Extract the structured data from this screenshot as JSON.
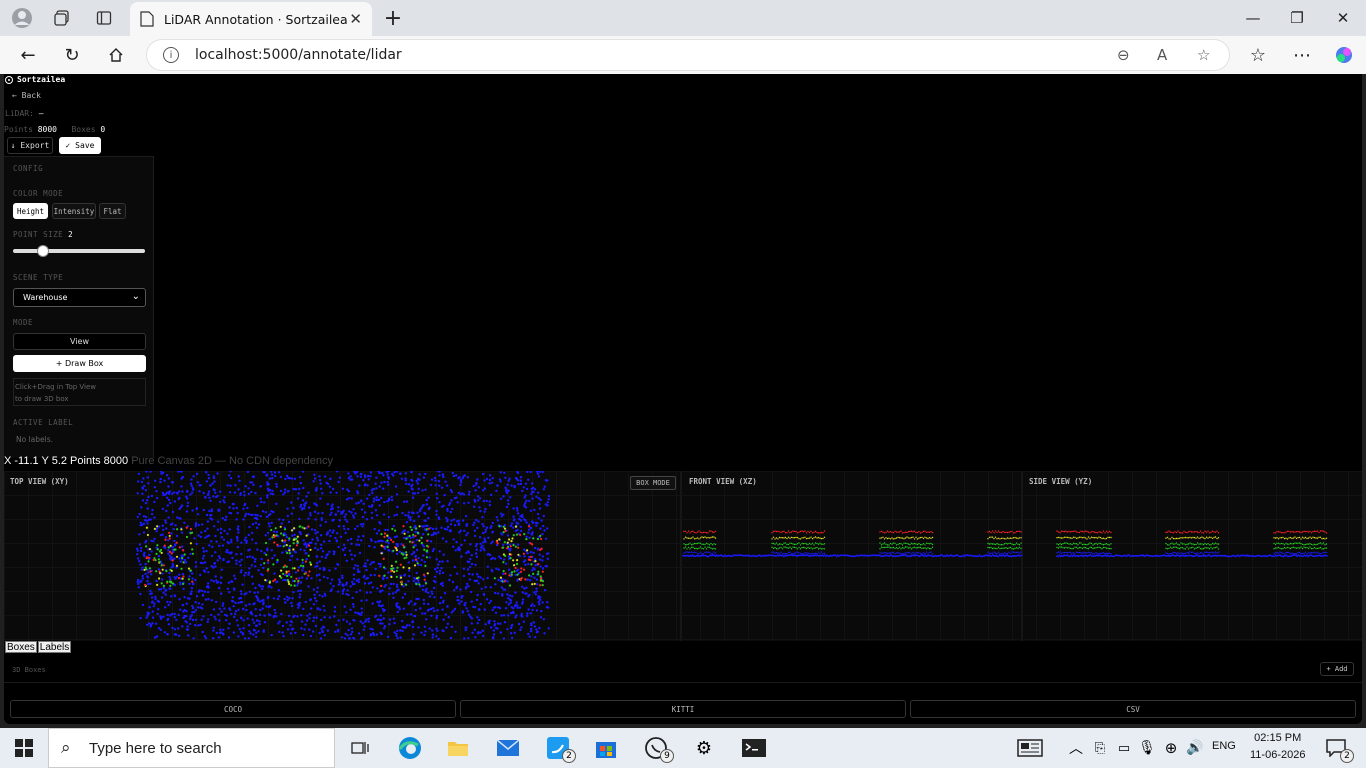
{
  "browser": {
    "tab_title": "LiDAR Annotation · Sortzailea",
    "url": "localhost:5000/annotate/lidar"
  },
  "app": {
    "brand": "Sortzailea",
    "back": "← Back",
    "lidar_label": "LiDAR:",
    "lidar_value": "—",
    "points_label": "Points",
    "points_value": "8000",
    "boxes_label": "Boxes",
    "boxes_value": "0",
    "export_btn": "↓ Export",
    "save_btn": "✓ Save"
  },
  "config": {
    "header": "CONFIG",
    "color_mode_label": "COLOR MODE",
    "color_modes": [
      "Height",
      "Intensity",
      "Flat"
    ],
    "color_mode_selected": "Height",
    "point_size_label": "POINT SIZE",
    "point_size_value": "2",
    "point_size_fraction": 0.22,
    "scene_type_label": "SCENE TYPE",
    "scene_type_value": "Warehouse",
    "mode_label": "MODE",
    "mode_view": "View",
    "mode_draw": "+ Draw Box",
    "hint_line1": "Click+Drag in Top View",
    "hint_line2": "to draw 3D box",
    "active_label_header": "ACTIVE LABEL",
    "no_labels": "No labels."
  },
  "status": {
    "coords": "X -11.1 Y 5.2 Points 8000",
    "sub": "Pure Canvas 2D — No CDN dependency"
  },
  "views": {
    "top": "TOP VIEW (XY)",
    "box_mode": "BOX MODE",
    "front": "FRONT VIEW (XZ)",
    "side": "SIDE VIEW (YZ)"
  },
  "bottom": {
    "tabs": [
      "Boxes",
      "Labels"
    ],
    "boxes_header": "3D Boxes",
    "add": "+ Add",
    "exports": [
      "COCO",
      "KITTI",
      "CSV"
    ]
  },
  "taskbar": {
    "search_placeholder": "Type here to search",
    "lang": "ENG",
    "time": "02:15 PM",
    "date": "11-06-2026",
    "twitter_badge": "2",
    "whatsapp_badge": "9",
    "notif_badge": "2"
  },
  "colors": {
    "accent_white": "#ffffff",
    "app_bg": "#000000",
    "point_blue": "#1a1aff",
    "point_green": "#22cc22",
    "point_red": "#ff2222",
    "point_yellow": "#dddd22"
  }
}
